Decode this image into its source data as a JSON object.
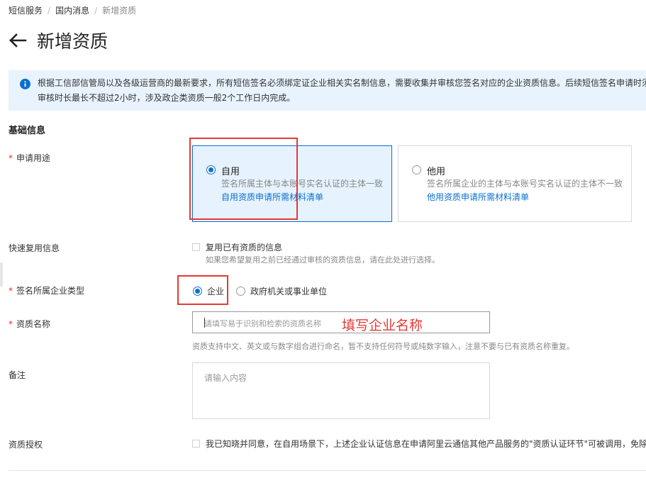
{
  "breadcrumb": {
    "items": [
      "短信服务",
      "国内消息",
      "新增资质"
    ]
  },
  "page": {
    "title": "新增资质",
    "back_icon": "arrow-left-icon"
  },
  "notice": {
    "icon": "info-icon",
    "line1": "根据工信部信管局以及各级运营商的最新要求，所有短信签名必须绑定证企业相关实名制信息，需要收集并审核您签名对应的企业资质信息。后续短信签名申请时须绑",
    "line2": "审核时长最长不超过2小时，涉及政企类资质一般2个工作日内完成。"
  },
  "section": {
    "basic_info": "基础信息"
  },
  "usage": {
    "label": "申请用途",
    "required_mark": "*",
    "options": [
      {
        "title": "自用",
        "desc": "签名所属主体与本账号实名认证的主体一致",
        "link": "自用资质申请所需材料清单",
        "selected": true
      },
      {
        "title": "他用",
        "desc": "签名所属企业的主体与本账号实名认证的主体不一致",
        "link": "他用资质申请所需材料清单",
        "selected": false
      }
    ]
  },
  "reuse": {
    "label": "快速复用信息",
    "checkbox_label": "复用已有资质的信息",
    "hint": "如果您希望复用之前已经通过审核的资质信息，请在此处进行选择。",
    "checked": false
  },
  "company_type": {
    "label": "签名所属企业类型",
    "required_mark": "*",
    "options": [
      {
        "label": "企业",
        "selected": true
      },
      {
        "label": "政府机关或事业单位",
        "selected": false
      }
    ]
  },
  "qual_name": {
    "label": "资质名称",
    "required_mark": "*",
    "placeholder": "请填写易于识别和检索的资质名称",
    "annotation": "填写企业名称",
    "hint": "资质支持中文、英文或与数字组合进行命名，暂不支持任何符号或纯数字输入，注意不要与已有资质名称重复。"
  },
  "remark": {
    "label": "备注",
    "placeholder": "请输入内容"
  },
  "authorization": {
    "label": "资质授权",
    "text": "我已知晓并同意，在自用场景下，上述企业认证信息在申请阿里云通信其他产品服务的\"资质认证环节\"可被调用，免除",
    "checked": false
  },
  "colors": {
    "primary": "#0a70d0",
    "notice_bg": "#e8f3fd",
    "required": "#d93026",
    "annotation_red": "#e53935"
  }
}
